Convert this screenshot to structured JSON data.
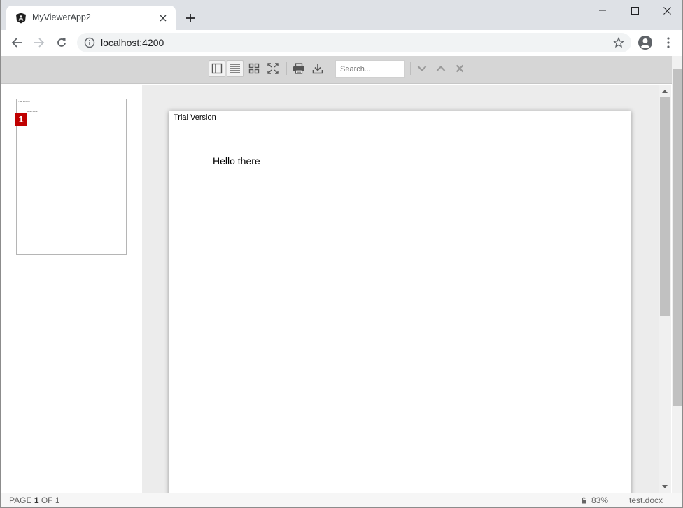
{
  "browser": {
    "tab_title": "MyViewerApp2",
    "url": "localhost:4200",
    "accent": "#dee1e6"
  },
  "viewer": {
    "toolbar": {
      "search_placeholder": "Search...",
      "buttons": [
        "toggle-sidebar",
        "single-page",
        "thumbnails",
        "fullscreen",
        "print",
        "download"
      ],
      "nav": [
        "next-result",
        "previous-result",
        "clear-search"
      ]
    },
    "thumbnail": {
      "page_number": "1",
      "trial_text": "Trial Version",
      "body_text": "Hello there"
    },
    "document": {
      "trial_text": "Trial Version",
      "body_text": "Hello there"
    },
    "status": {
      "page_label": "PAGE",
      "current_page": "1",
      "of_label": "OF",
      "total_pages": "1",
      "zoom": "83%",
      "file_name": "test.docx"
    },
    "colors": {
      "page_badge": "#c00000",
      "toolbar_bg": "#d6d6d6",
      "doc_bg": "#ececec"
    }
  }
}
